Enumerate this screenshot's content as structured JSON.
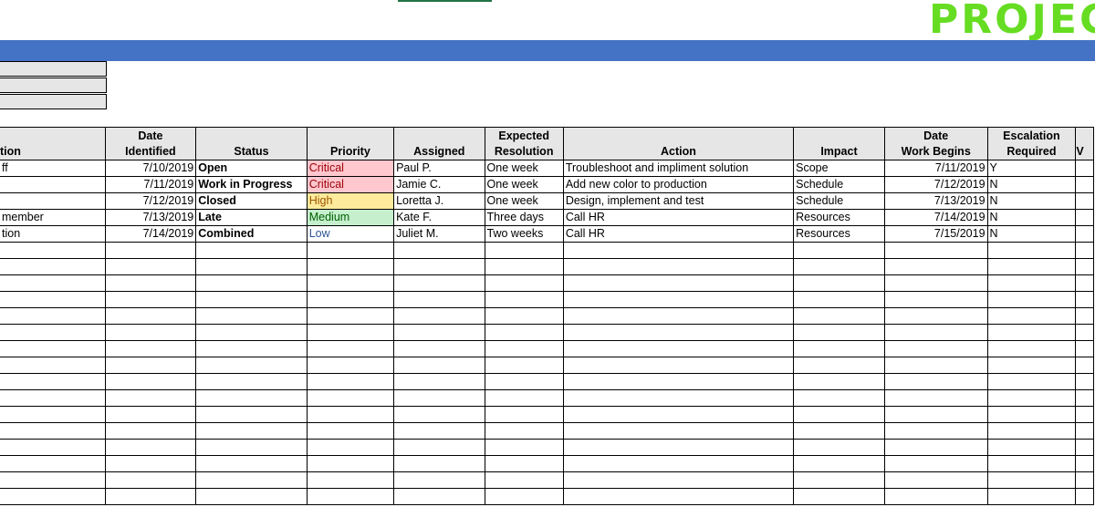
{
  "header": {
    "title": "PROJEC",
    "title_color": "#66dd22",
    "bar_color": "#4472c4"
  },
  "columns": [
    {
      "line1": "",
      "line2": "tion"
    },
    {
      "line1": "Date",
      "line2": "Identified"
    },
    {
      "line1": "",
      "line2": "Status"
    },
    {
      "line1": "",
      "line2": "Priority"
    },
    {
      "line1": "",
      "line2": "Assigned"
    },
    {
      "line1": "Expected",
      "line2": "Resolution"
    },
    {
      "line1": "",
      "line2": "Action"
    },
    {
      "line1": "",
      "line2": "Impact"
    },
    {
      "line1": "Date",
      "line2": "Work Begins"
    },
    {
      "line1": "Escalation",
      "line2": "Required"
    },
    {
      "line1": "",
      "line2": "V"
    }
  ],
  "rows": [
    {
      "description": "ff",
      "date_identified": "7/10/2019",
      "status": "Open",
      "priority": "Critical",
      "assigned": "Paul P.",
      "expected": "One week",
      "action": "Troubleshoot and impliment solution",
      "impact": "Scope",
      "work_begins": "7/11/2019",
      "escalation": "Y"
    },
    {
      "description": "",
      "date_identified": "7/11/2019",
      "status": "Work in Progress",
      "priority": "Critical",
      "assigned": "Jamie C.",
      "expected": "One week",
      "action": "Add new color to production",
      "impact": "Schedule",
      "work_begins": "7/12/2019",
      "escalation": "N"
    },
    {
      "description": "",
      "date_identified": "7/12/2019",
      "status": "Closed",
      "priority": "High",
      "assigned": "Loretta J.",
      "expected": "One week",
      "action": "Design, implement and test",
      "impact": "Schedule",
      "work_begins": "7/13/2019",
      "escalation": "N"
    },
    {
      "description": "member",
      "date_identified": "7/13/2019",
      "status": "Late",
      "priority": "Medium",
      "assigned": "Kate F.",
      "expected": "Three days",
      "action": "Call HR",
      "impact": "Resources",
      "work_begins": "7/14/2019",
      "escalation": "N"
    },
    {
      "description": "tion",
      "date_identified": "7/14/2019",
      "status": "Combined",
      "priority": "Low",
      "assigned": "Juliet M.",
      "expected": "Two weeks",
      "action": "Call HR",
      "impact": "Resources",
      "work_begins": "7/15/2019",
      "escalation": "N"
    }
  ],
  "priority_colors": {
    "Critical": {
      "bg": "#ffc7ce",
      "fg": "#9c0006"
    },
    "High": {
      "bg": "#ffeb9c",
      "fg": "#9c5700"
    },
    "Medium": {
      "bg": "#c6efce",
      "fg": "#006100"
    },
    "Low": {
      "bg": "",
      "fg": "#2f5597"
    }
  }
}
